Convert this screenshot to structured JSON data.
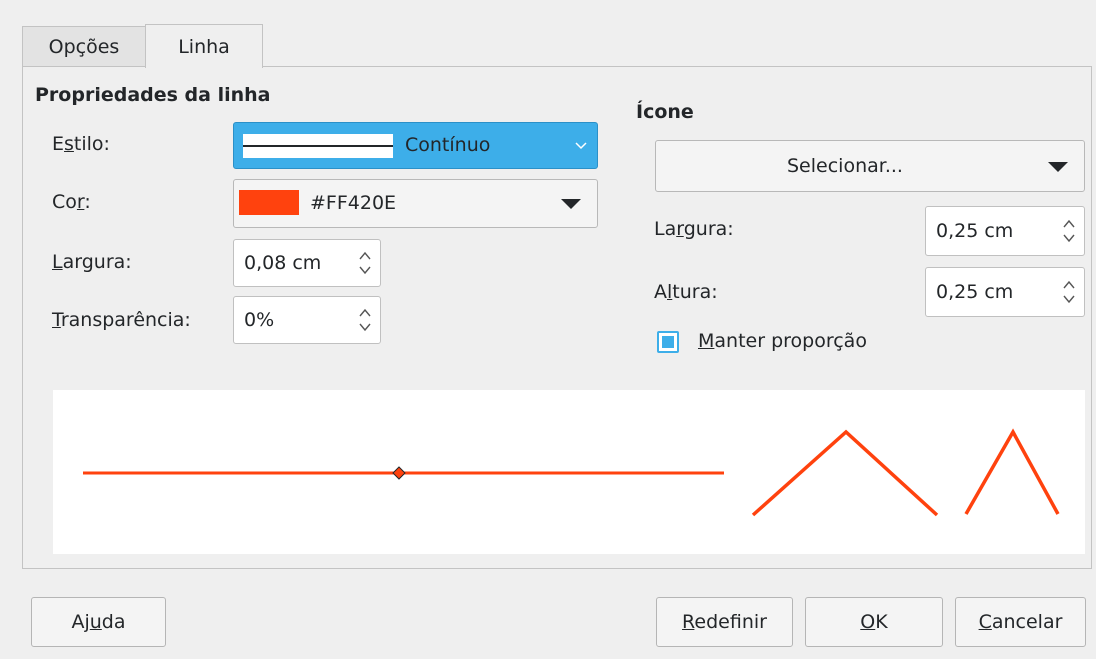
{
  "tabs": [
    {
      "label": "Opções",
      "active": false
    },
    {
      "label": "Linha",
      "active": true
    }
  ],
  "line_properties": {
    "title": "Propriedades da linha",
    "style_label_pre": "E",
    "style_label_u": "s",
    "style_label_post": "tilo:",
    "style_value": "Contínuo",
    "color_label_pre": "Co",
    "color_label_u": "r",
    "color_label_post": ":",
    "color_hex": "#FF420E",
    "color_value": "#FF420E",
    "width_label_u": "L",
    "width_label_post": "argura:",
    "width_value": "0,08 cm",
    "transparency_label_u": "T",
    "transparency_label_post": "ransparência:",
    "transparency_value": "0%"
  },
  "icon": {
    "title": "Ícone",
    "select_label": "Selecionar...",
    "width_label_pre": "La",
    "width_label_u": "r",
    "width_label_post": "gura:",
    "width_value": "0,25 cm",
    "height_label_pre": "A",
    "height_label_u": "l",
    "height_label_post": "tura:",
    "height_value": "0,25 cm",
    "keep_ratio_label_u": "M",
    "keep_ratio_label_post": "anter proporção",
    "keep_ratio_checked": true
  },
  "buttons": {
    "help_pre": "Aj",
    "help_u": "u",
    "help_post": "da",
    "reset_u": "R",
    "reset_post": "edefinir",
    "ok_u": "O",
    "ok_post": "K",
    "cancel_u": "C",
    "cancel_post": "ancelar"
  },
  "colors": {
    "accent": "#3daee9",
    "line": "#FF420E"
  }
}
